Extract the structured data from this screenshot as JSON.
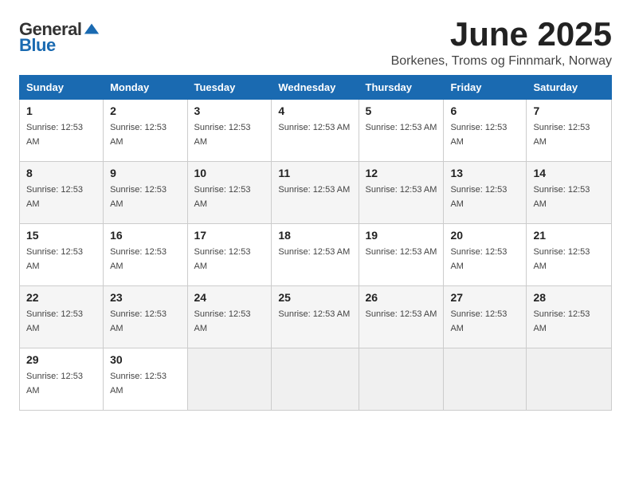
{
  "logo": {
    "general": "General",
    "blue": "Blue"
  },
  "title": "June 2025",
  "location": "Borkenes, Troms og Finnmark, Norway",
  "columns": [
    "Sunday",
    "Monday",
    "Tuesday",
    "Wednesday",
    "Thursday",
    "Friday",
    "Saturday"
  ],
  "sunrise_time": "12:53 AM",
  "weeks": [
    [
      {
        "day": "1",
        "sunrise": "Sunrise: 12:53 AM"
      },
      {
        "day": "2",
        "sunrise": "Sunrise: 12:53 AM"
      },
      {
        "day": "3",
        "sunrise": "Sunrise: 12:53 AM"
      },
      {
        "day": "4",
        "sunrise": "Sunrise: 12:53 AM"
      },
      {
        "day": "5",
        "sunrise": "Sunrise: 12:53 AM"
      },
      {
        "day": "6",
        "sunrise": "Sunrise: 12:53 AM"
      },
      {
        "day": "7",
        "sunrise": "Sunrise: 12:53 AM"
      }
    ],
    [
      {
        "day": "8",
        "sunrise": "Sunrise: 12:53 AM"
      },
      {
        "day": "9",
        "sunrise": "Sunrise: 12:53 AM"
      },
      {
        "day": "10",
        "sunrise": "Sunrise: 12:53 AM"
      },
      {
        "day": "11",
        "sunrise": "Sunrise: 12:53 AM"
      },
      {
        "day": "12",
        "sunrise": "Sunrise: 12:53 AM"
      },
      {
        "day": "13",
        "sunrise": "Sunrise: 12:53 AM"
      },
      {
        "day": "14",
        "sunrise": "Sunrise: 12:53 AM"
      }
    ],
    [
      {
        "day": "15",
        "sunrise": "Sunrise: 12:53 AM"
      },
      {
        "day": "16",
        "sunrise": "Sunrise: 12:53 AM"
      },
      {
        "day": "17",
        "sunrise": "Sunrise: 12:53 AM"
      },
      {
        "day": "18",
        "sunrise": "Sunrise: 12:53 AM"
      },
      {
        "day": "19",
        "sunrise": "Sunrise: 12:53 AM"
      },
      {
        "day": "20",
        "sunrise": "Sunrise: 12:53 AM"
      },
      {
        "day": "21",
        "sunrise": "Sunrise: 12:53 AM"
      }
    ],
    [
      {
        "day": "22",
        "sunrise": "Sunrise: 12:53 AM"
      },
      {
        "day": "23",
        "sunrise": "Sunrise: 12:53 AM"
      },
      {
        "day": "24",
        "sunrise": "Sunrise: 12:53 AM"
      },
      {
        "day": "25",
        "sunrise": "Sunrise: 12:53 AM"
      },
      {
        "day": "26",
        "sunrise": "Sunrise: 12:53 AM"
      },
      {
        "day": "27",
        "sunrise": "Sunrise: 12:53 AM"
      },
      {
        "day": "28",
        "sunrise": "Sunrise: 12:53 AM"
      }
    ],
    [
      {
        "day": "29",
        "sunrise": "Sunrise: 12:53 AM"
      },
      {
        "day": "30",
        "sunrise": "Sunrise: 12:53 AM"
      },
      null,
      null,
      null,
      null,
      null
    ]
  ]
}
